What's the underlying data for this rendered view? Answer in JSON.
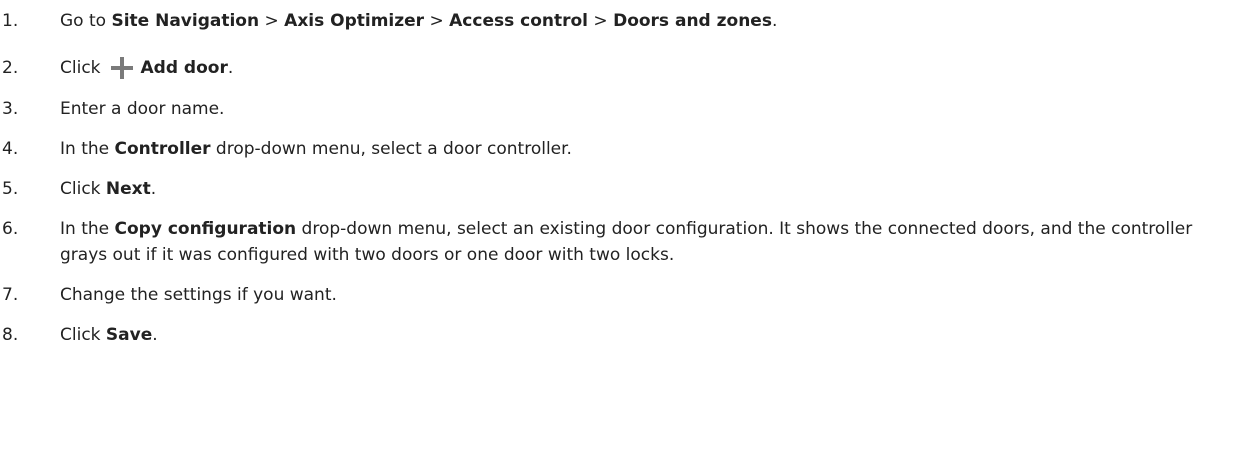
{
  "steps": [
    {
      "num": "1.",
      "t1": "Go to ",
      "b1": "Site Navigation",
      "t2": " > ",
      "b2": "Axis Optimizer",
      "t3": " > ",
      "b3": "Access control",
      "t4": " > ",
      "b4": "Doors and zones",
      "t5": "."
    },
    {
      "num": "2.",
      "t1": "Click",
      "icon": "plus-icon",
      "b1": "Add door",
      "t2": "."
    },
    {
      "num": "3.",
      "t1": "Enter a door name."
    },
    {
      "num": "4.",
      "t1": "In the ",
      "b1": "Controller",
      "t2": " drop-down menu, select a door controller."
    },
    {
      "num": "5.",
      "t1": "Click ",
      "b1": "Next",
      "t2": "."
    },
    {
      "num": "6.",
      "t1": "In the ",
      "b1": "Copy configuration",
      "t2": " drop-down menu, select an existing door configuration. It shows the connected doors, and the controller grays out if it was configured with two doors or one door with two locks."
    },
    {
      "num": "7.",
      "t1": "Change the settings if you want."
    },
    {
      "num": "8.",
      "t1": "Click ",
      "b1": "Save",
      "t2": "."
    }
  ]
}
